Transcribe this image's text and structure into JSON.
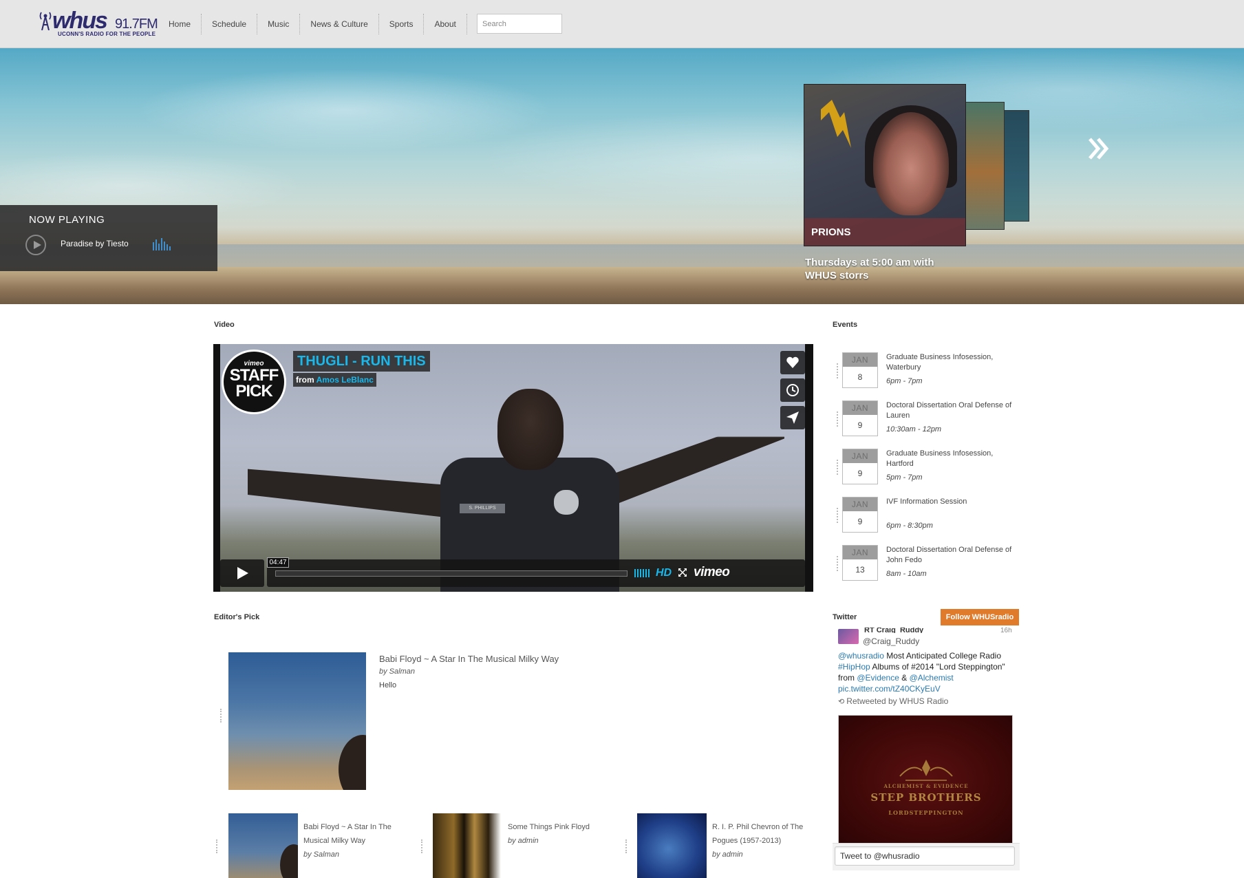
{
  "header": {
    "logo_brand": "whus",
    "logo_freq": "91.7FM",
    "logo_tagline": "UCONN'S RADIO FOR THE PEOPLE",
    "nav": [
      "Home",
      "Schedule",
      "Music",
      "News & Culture",
      "Sports",
      "About"
    ],
    "search_placeholder": "Search"
  },
  "now_playing": {
    "title": "NOW PLAYING",
    "track": "Paradise by Tiesto"
  },
  "featured_show": {
    "name": "PRIONS",
    "schedule": "Thursdays at 5:00 am with WHUS storrs"
  },
  "video": {
    "section_title": "Video",
    "badge_top": "vimeo",
    "badge_line1": "STAFF",
    "badge_line2": "PICK",
    "title": "THUGLI - RUN THIS",
    "from_label": "from",
    "author": "Amos LeBlanc",
    "duration": "04:47",
    "hd_label": "HD",
    "brand": "vimeo",
    "nametag": "S. PHILLIPS",
    "accent_color": "#1ab7ea"
  },
  "events": {
    "section_title": "Events",
    "items": [
      {
        "month": "JAN",
        "day": "8",
        "title": "Graduate Business Infosession, Waterbury",
        "time": "6pm - 7pm"
      },
      {
        "month": "JAN",
        "day": "9",
        "title": "Doctoral Dissertation Oral Defense of Lauren",
        "time": "10:30am - 12pm"
      },
      {
        "month": "JAN",
        "day": "9",
        "title": "Graduate Business Infosession, Hartford",
        "time": "5pm - 7pm"
      },
      {
        "month": "JAN",
        "day": "9",
        "title": "IVF Information Session",
        "time": "6pm - 8:30pm"
      },
      {
        "month": "JAN",
        "day": "13",
        "title": "Doctoral Dissertation Oral Defense of John Fedo",
        "time": "8am - 10am"
      }
    ]
  },
  "twitter": {
    "section_title": "Twitter",
    "follow_label": "Follow WHUSradio",
    "accent_color": "#e07b2c",
    "tweet": {
      "top_name": "RT Craig_Ruddy",
      "handle": "@Craig_Ruddy",
      "age": "16h",
      "mention": "@whusradio",
      "text_1": " Most Anticipated College Radio ",
      "hashtag": "#HipHop",
      "text_2": " Albums of #2014  \"Lord Steppington\" from ",
      "link_1": "@Evidence",
      "text_3": " & ",
      "link_2": "@Alchemist",
      "pic_link": "pic.twitter.com/tZ40CKyEuV",
      "retweeted_by": "Retweeted by WHUS Radio"
    },
    "image_small": "ALCHEMIST & EVIDENCE",
    "image_big": "STEP BROTHERS",
    "image_sub": "LORDSTEPPINGTON",
    "input_placeholder": "Tweet to @whusradio"
  },
  "editors_pick": {
    "section_title": "Editor's Pick",
    "main": {
      "title": "Babi Floyd ~ A Star In The Musical Milky Way",
      "by": "by Salman",
      "desc": "Hello"
    },
    "items": [
      {
        "title": "Babi Floyd ~ A Star In The Musical Milky Way",
        "by": "by Salman"
      },
      {
        "title": "Some Things Pink Floyd",
        "by": "by admin"
      },
      {
        "title": "R. I. P. Phil Chevron of The Pogues (1957-2013)",
        "by": "by admin"
      }
    ]
  }
}
